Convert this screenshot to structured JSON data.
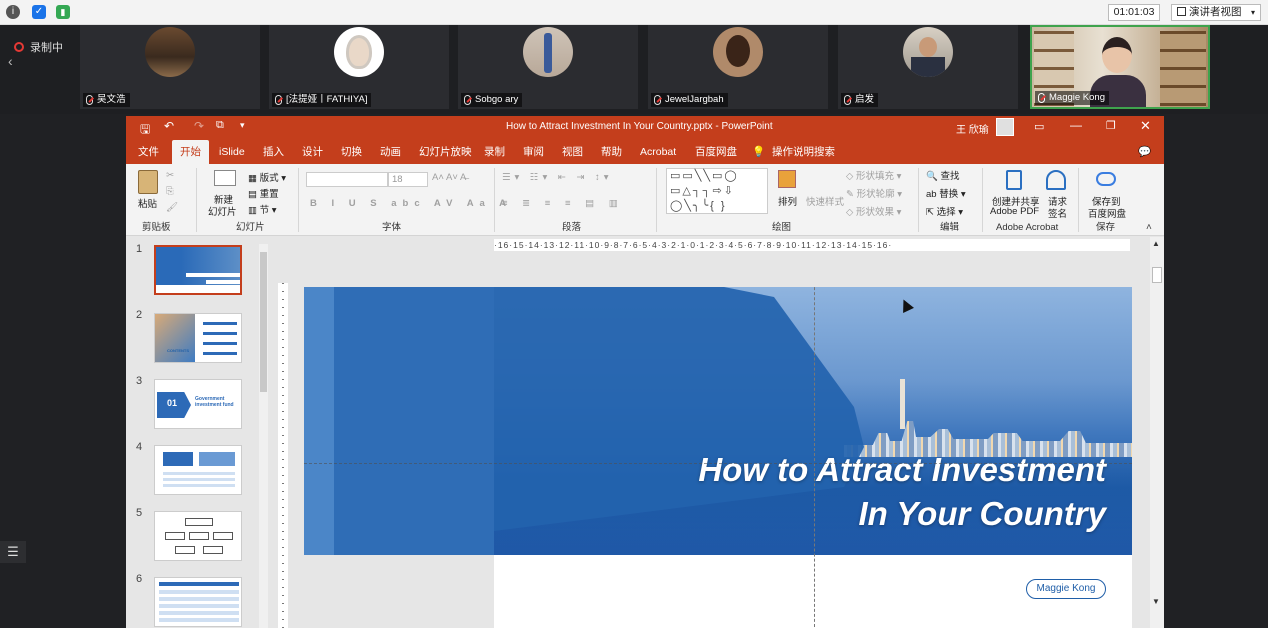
{
  "meeting": {
    "timer": "01:01:03",
    "view_mode": "演讲者视图",
    "recording_label": "录制中",
    "participants": [
      {
        "name": "吴文浩"
      },
      {
        "name": "[法提娅丨FATHIYA]"
      },
      {
        "name": "Sobgo ary"
      },
      {
        "name": "JewelJargbah"
      },
      {
        "name": "启发"
      },
      {
        "name": "Maggie Kong"
      }
    ]
  },
  "ppt": {
    "window_title": "How to Attract Investment In Your Country.pptx  -  PowerPoint",
    "user": "王 欣瑜",
    "tabs": [
      "文件",
      "开始",
      "iSlide",
      "插入",
      "设计",
      "切换",
      "动画",
      "幻灯片放映",
      "录制",
      "审阅",
      "视图",
      "帮助",
      "Acrobat",
      "百度网盘"
    ],
    "tell_me": "操作说明搜索",
    "ribbon": {
      "clipboard": {
        "paste": "粘贴",
        "group": "剪贴板"
      },
      "slides": {
        "new_slide_1": "新建",
        "new_slide_2": "幻灯片",
        "layout": "版式",
        "reset": "重置",
        "section": "节",
        "group": "幻灯片"
      },
      "font": {
        "size": "18",
        "group": "字体"
      },
      "paragraph": {
        "group": "段落"
      },
      "drawing": {
        "arrange": "排列",
        "quick_styles": "快速样式",
        "shape_fill": "形状填充",
        "shape_outline": "形状轮廓",
        "shape_effects": "形状效果",
        "group": "绘图"
      },
      "editing": {
        "find": "查找",
        "replace": "替换",
        "select": "选择",
        "group": "编辑"
      },
      "acrobat": {
        "create_share_1": "创建并共享",
        "create_share_2": "Adobe PDF",
        "request_sign_1": "请求",
        "request_sign_2": "签名",
        "group": "Adobe Acrobat"
      },
      "save": {
        "save_to_1": "保存到",
        "save_to_2": "百度网盘",
        "group": "保存"
      }
    },
    "ruler": "·16·15·14·13·12·11·10·9·8·7·6·5·4·3·2·1·0·1·2·3·4·5·6·7·8·9·10·11·12·13·14·15·16·",
    "thumbnails": [
      {
        "num": "1"
      },
      {
        "num": "2",
        "text": "CONTENTS"
      },
      {
        "num": "3",
        "text": "01",
        "title": "Government investment fund"
      },
      {
        "num": "4"
      },
      {
        "num": "5"
      },
      {
        "num": "6"
      }
    ],
    "slide": {
      "title_line1": "How to Attract Investment",
      "title_line2": "In Your Country",
      "presenter": "Maggie Kong"
    }
  }
}
